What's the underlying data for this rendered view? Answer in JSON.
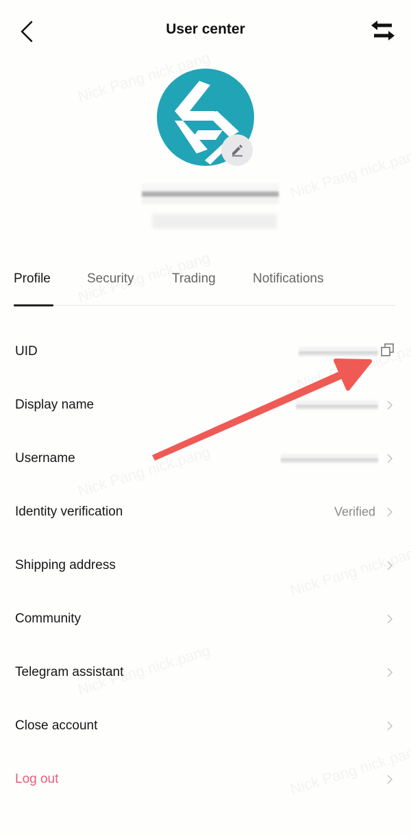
{
  "header": {
    "title": "User center",
    "back_icon": "chevron-left-icon",
    "switch_icon": "swap-arrows-icon"
  },
  "profile": {
    "avatar_icon": "exchange-logo-icon",
    "avatar_color": "#21a4b6",
    "edit_icon": "pencil-icon",
    "name_redacted": true,
    "subtitle_redacted": true
  },
  "tabs": [
    {
      "label": "Profile",
      "active": true
    },
    {
      "label": "Security",
      "active": false
    },
    {
      "label": "Trading",
      "active": false
    },
    {
      "label": "Notifications",
      "active": false
    }
  ],
  "rows": [
    {
      "label": "UID",
      "value": "",
      "redacted": true,
      "trailing_icon": "copy-icon"
    },
    {
      "label": "Display name",
      "value": "",
      "redacted": true,
      "trailing_icon": "chevron-right-icon"
    },
    {
      "label": "Username",
      "value": "",
      "redacted": true,
      "trailing_icon": "chevron-right-icon"
    },
    {
      "label": "Identity verification",
      "value": "Verified",
      "redacted": false,
      "trailing_icon": "chevron-right-icon"
    },
    {
      "label": "Shipping address",
      "value": "",
      "trailing_icon": "chevron-right-icon"
    },
    {
      "label": "Community",
      "value": "",
      "trailing_icon": "chevron-right-icon"
    },
    {
      "label": "Telegram assistant",
      "value": "",
      "trailing_icon": "chevron-right-icon"
    },
    {
      "label": "Close account",
      "value": "",
      "trailing_icon": "chevron-right-icon"
    },
    {
      "label": "Log out",
      "value": "",
      "trailing_icon": "chevron-right-icon",
      "danger": true
    }
  ],
  "watermark": "Nick Pang nick.pang",
  "annotation": {
    "type": "arrow",
    "color": "#ef5a55",
    "points_to": "uid-copy-icon"
  },
  "colors": {
    "danger": "#ea5d79",
    "muted": "#8a8a8a"
  }
}
